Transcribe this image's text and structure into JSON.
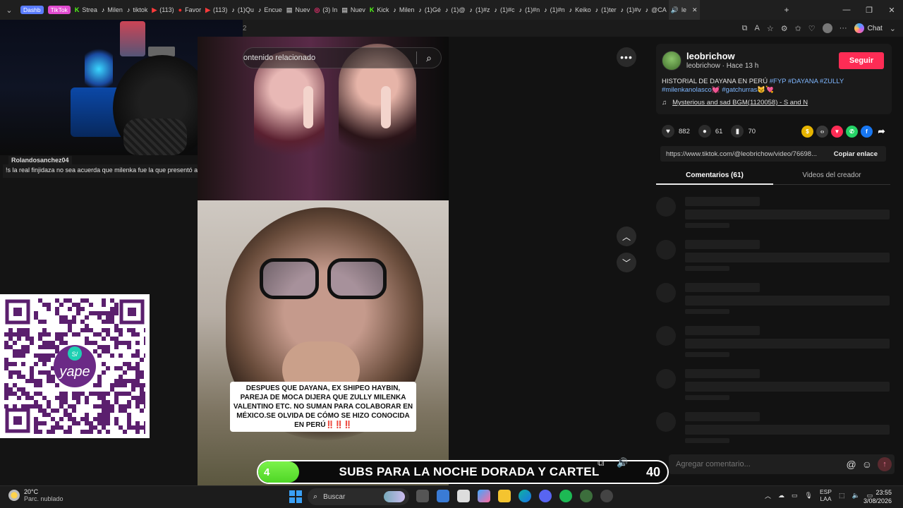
{
  "browser": {
    "tabs": [
      {
        "label": "Dashb",
        "pill": true,
        "pill_color": "#5a7cff"
      },
      {
        "label": "TikTok",
        "pill": true,
        "pill_color": "#e14bd0"
      },
      {
        "label": "Strea",
        "icon": "kick-icon"
      },
      {
        "label": "Milen",
        "icon": "tiktok-icon"
      },
      {
        "label": "tiktok",
        "icon": "tiktok-icon"
      },
      {
        "label": "(113)",
        "icon": "youtube-icon"
      },
      {
        "label": "Favor",
        "icon": "red-icon"
      },
      {
        "label": "(113)",
        "icon": "youtube-icon"
      },
      {
        "label": "(1)Qu",
        "icon": "tiktok-icon"
      },
      {
        "label": "Encue",
        "icon": "tiktok-icon"
      },
      {
        "label": "Nuev",
        "icon": "page-icon"
      },
      {
        "label": "(3) In",
        "icon": "instagram-icon"
      },
      {
        "label": "Nuev",
        "icon": "page-icon"
      },
      {
        "label": "Kick",
        "icon": "kick-icon"
      },
      {
        "label": "Milen",
        "icon": "tiktok-icon"
      },
      {
        "label": "(1)Gé",
        "icon": "tiktok-icon"
      },
      {
        "label": "(1)@",
        "icon": "tiktok-icon"
      },
      {
        "label": "(1)#z",
        "icon": "tiktok-icon"
      },
      {
        "label": "(1)#c",
        "icon": "tiktok-icon"
      },
      {
        "label": "(1)#n",
        "icon": "tiktok-icon"
      },
      {
        "label": "(1)#n",
        "icon": "tiktok-icon"
      },
      {
        "label": "Keiko",
        "icon": "tiktok-icon"
      },
      {
        "label": "(1)ter",
        "icon": "tiktok-icon"
      },
      {
        "label": "(1)#v",
        "icon": "tiktok-icon"
      },
      {
        "label": "@CA",
        "icon": "tiktok-icon"
      },
      {
        "label": "le",
        "icon": "speaker-icon",
        "active": true
      }
    ],
    "url_fragment": "2",
    "chat_label": "Chat"
  },
  "stream_overlay": {
    "chat_username": "Rolandosanchez04",
    "chat_message": "!s la real finjidaza no sea acuerda que milenka fue la que presentó a kuki",
    "qr_brand": "yape"
  },
  "video": {
    "search_placeholder": "ontenido relacionado",
    "caption": "DESPUES QUE DAYANA, EX SHIPEO HAYBIN, PAREJA DE MOCA DIJERA QUE ZULLY MILENKA VALENTINO ETC. NO SUMAN PARA COLABORAR EN MÉXICO.SE OLVIDA DE CÓMO SE HIZO CONOCIDA EN PERÚ‼️‼️‼️"
  },
  "post": {
    "author_name": "leobrichow",
    "author_sub": "leobrichow · Hace 13 h",
    "follow_label": "Seguir",
    "description_text": "HISTORIAL DE DAYANA EN PERÚ ",
    "hashtags_line1": "#FYP #DAYANA #ZULLY",
    "hashtag_milenka": "#milenkanolasco",
    "hashtag_gatchurras": "#gatchurras",
    "music": "Mysterious and sad BGM(1120058) - S and N",
    "likes": "882",
    "comments": "61",
    "saves": "70",
    "link_url": "https://www.tiktok.com/@leobrichow/video/76698...",
    "copy_label": "Copiar enlace",
    "tab_comments": "Comentarios (61)",
    "tab_videos": "Videos del creador",
    "comment_placeholder": "Agregar comentario..."
  },
  "goal": {
    "current": "4",
    "text": "SUBS PARA LA NOCHE DORADA Y CARTEL",
    "target": "40",
    "progress_fraction": 0.1,
    "fill_color": "#4fd626"
  },
  "taskbar": {
    "temp": "20°C",
    "weather": "Parc. nublado",
    "search_label": "Buscar",
    "lang_top": "ESP",
    "lang_bottom": "LAA",
    "time": "23:55",
    "date": "3/08/2026"
  }
}
